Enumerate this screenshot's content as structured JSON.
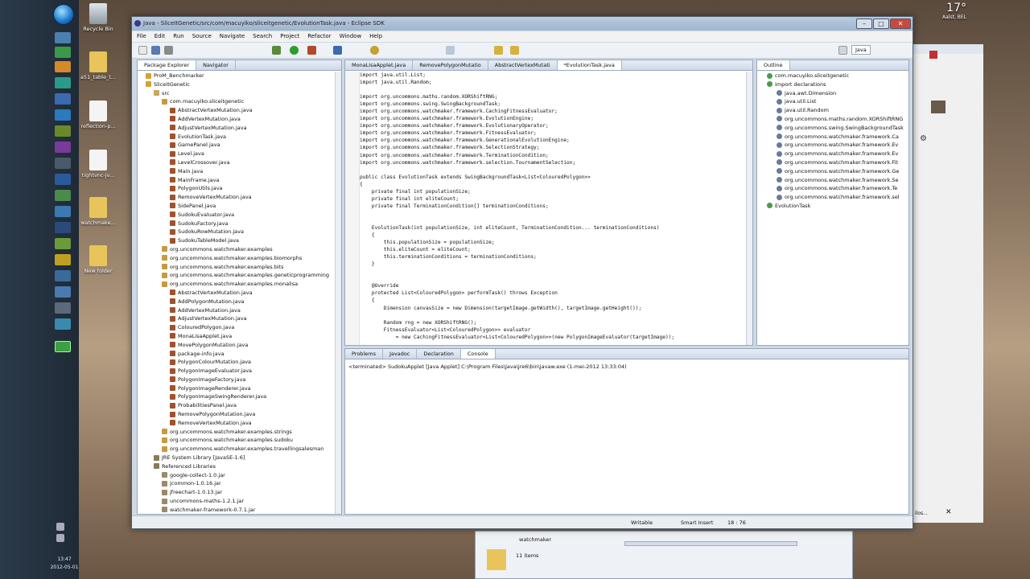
{
  "taskbar": {
    "time": "13:47",
    "date": "2012-05-01",
    "weather_temp": "17°",
    "weather_place": "Aalst, BEL"
  },
  "desktop_icons": [
    {
      "label": "Recycle Bin"
    },
    {
      "label": "a51_table_t..."
    },
    {
      "label": "reflection-p..."
    },
    {
      "label": "tightvnc-jv..."
    },
    {
      "label": "watchmake..."
    },
    {
      "label": "New folder"
    }
  ],
  "explorer": {
    "folder": "watchmaker",
    "count": "11 items"
  },
  "right_window": {
    "text": "ilos..."
  },
  "eclipse": {
    "title": "Java - SliceItGenetic/src/com/macuyiko/sliceitgenetic/EvolutionTask.java - Eclipse SDK",
    "menu": [
      "File",
      "Edit",
      "Run",
      "Source",
      "Navigate",
      "Search",
      "Project",
      "Refactor",
      "Window",
      "Help"
    ],
    "perspective": "Java",
    "left_tabs": [
      "Package Explorer",
      "Navigator"
    ],
    "package_tree": [
      {
        "label": "ProM_Benchmarker",
        "indent": 1,
        "kind": "project"
      },
      {
        "label": "SliceItGenetic",
        "indent": 1,
        "kind": "project"
      },
      {
        "label": "src",
        "indent": 2,
        "kind": "folder"
      },
      {
        "label": "com.macuyiko.sliceitgenetic",
        "indent": 3,
        "kind": "package"
      },
      {
        "label": "AbstractVertexMutation.java",
        "indent": 4,
        "kind": "file"
      },
      {
        "label": "AddVertexMutation.java",
        "indent": 4,
        "kind": "file"
      },
      {
        "label": "AdjustVertexMutation.java",
        "indent": 4,
        "kind": "file"
      },
      {
        "label": "EvolutionTask.java",
        "indent": 4,
        "kind": "file"
      },
      {
        "label": "GamePanel.java",
        "indent": 4,
        "kind": "file"
      },
      {
        "label": "Level.java",
        "indent": 4,
        "kind": "file"
      },
      {
        "label": "LevelCrossover.java",
        "indent": 4,
        "kind": "file"
      },
      {
        "label": "Main.java",
        "indent": 4,
        "kind": "file"
      },
      {
        "label": "MainFrame.java",
        "indent": 4,
        "kind": "file"
      },
      {
        "label": "PolygonUtils.java",
        "indent": 4,
        "kind": "file"
      },
      {
        "label": "RemoveVertexMutation.java",
        "indent": 4,
        "kind": "file"
      },
      {
        "label": "SidePanel.java",
        "indent": 4,
        "kind": "file"
      },
      {
        "label": "SudokuEvaluator.java",
        "indent": 4,
        "kind": "file"
      },
      {
        "label": "SudokuFactory.java",
        "indent": 4,
        "kind": "file"
      },
      {
        "label": "SudokuRowMutation.java",
        "indent": 4,
        "kind": "file"
      },
      {
        "label": "SudokuTableModel.java",
        "indent": 4,
        "kind": "file"
      },
      {
        "label": "org.uncommons.watchmaker.examples",
        "indent": 3,
        "kind": "package"
      },
      {
        "label": "org.uncommons.watchmaker.examples.biomorphs",
        "indent": 3,
        "kind": "package"
      },
      {
        "label": "org.uncommons.watchmaker.examples.bits",
        "indent": 3,
        "kind": "package"
      },
      {
        "label": "org.uncommons.watchmaker.examples.geneticprogramming",
        "indent": 3,
        "kind": "package"
      },
      {
        "label": "org.uncommons.watchmaker.examples.monalisa",
        "indent": 3,
        "kind": "package"
      },
      {
        "label": "AbstractVertexMutation.java",
        "indent": 4,
        "kind": "file"
      },
      {
        "label": "AddPolygonMutation.java",
        "indent": 4,
        "kind": "file"
      },
      {
        "label": "AddVertexMutation.java",
        "indent": 4,
        "kind": "file"
      },
      {
        "label": "AdjustVertexMutation.java",
        "indent": 4,
        "kind": "file"
      },
      {
        "label": "ColouredPolygon.java",
        "indent": 4,
        "kind": "file"
      },
      {
        "label": "MonaLisaApplet.java",
        "indent": 4,
        "kind": "file"
      },
      {
        "label": "MovePolygonMutation.java",
        "indent": 4,
        "kind": "file"
      },
      {
        "label": "package-info.java",
        "indent": 4,
        "kind": "file"
      },
      {
        "label": "PolygonColourMutation.java",
        "indent": 4,
        "kind": "file"
      },
      {
        "label": "PolygonImageEvaluator.java",
        "indent": 4,
        "kind": "file"
      },
      {
        "label": "PolygonImageFactory.java",
        "indent": 4,
        "kind": "file"
      },
      {
        "label": "PolygonImageRenderer.java",
        "indent": 4,
        "kind": "file"
      },
      {
        "label": "PolygonImageSwingRenderer.java",
        "indent": 4,
        "kind": "file"
      },
      {
        "label": "ProbabilitiesPanel.java",
        "indent": 4,
        "kind": "file"
      },
      {
        "label": "RemovePolygonMutation.java",
        "indent": 4,
        "kind": "file"
      },
      {
        "label": "RemoveVertexMutation.java",
        "indent": 4,
        "kind": "file"
      },
      {
        "label": "org.uncommons.watchmaker.examples.strings",
        "indent": 3,
        "kind": "package"
      },
      {
        "label": "org.uncommons.watchmaker.examples.sudoku",
        "indent": 3,
        "kind": "package"
      },
      {
        "label": "org.uncommons.watchmaker.examples.travellingsalesman",
        "indent": 3,
        "kind": "package"
      },
      {
        "label": "JRE System Library [JavaSE-1.6]",
        "indent": 2,
        "kind": "lib"
      },
      {
        "label": "Referenced Libraries",
        "indent": 2,
        "kind": "lib"
      },
      {
        "label": "google-collect-1.0.jar",
        "indent": 3,
        "kind": "jar"
      },
      {
        "label": "jcommon-1.0.16.jar",
        "indent": 3,
        "kind": "jar"
      },
      {
        "label": "jfreechart-1.0.13.jar",
        "indent": 3,
        "kind": "jar"
      },
      {
        "label": "uncommons-maths-1.2.1.jar",
        "indent": 3,
        "kind": "jar"
      },
      {
        "label": "watchmaker-framework-0.7.1.jar",
        "indent": 3,
        "kind": "jar"
      }
    ],
    "editor_tabs": [
      "MonaLisaApplet.java",
      "RemovePolygonMutatio",
      "AbstractVertexMutati",
      "*EvolutionTask.java"
    ],
    "code_lines": [
      "import java.util.List;",
      "import java.util.Random;",
      "",
      "import org.uncommons.maths.random.XORShiftRNG;",
      "import org.uncommons.swing.SwingBackgroundTask;",
      "import org.uncommons.watchmaker.framework.CachingFitnessEvaluator;",
      "import org.uncommons.watchmaker.framework.EvolutionEngine;",
      "import org.uncommons.watchmaker.framework.EvolutionaryOperator;",
      "import org.uncommons.watchmaker.framework.FitnessEvaluator;",
      "import org.uncommons.watchmaker.framework.GenerationalEvolutionEngine;",
      "import org.uncommons.watchmaker.framework.SelectionStrategy;",
      "import org.uncommons.watchmaker.framework.TerminationCondition;",
      "import org.uncommons.watchmaker.framework.selection.TournamentSelection;",
      "",
      "public class EvolutionTask extends SwingBackgroundTask<List<ColouredPolygon>>",
      "{",
      "    private final int populationSize;",
      "    private final int eliteCount;",
      "    private final TerminationCondition[] terminationConditions;",
      "",
      "",
      "    EvolutionTask(int populationSize, int eliteCount, TerminationCondition... terminationConditions)",
      "    {",
      "        this.populationSize = populationSize;",
      "        this.eliteCount = eliteCount;",
      "        this.terminationConditions = terminationConditions;",
      "    }",
      "",
      "",
      "    @Override",
      "    protected List<ColouredPolygon> performTask() throws Exception",
      "    {",
      "        Dimension canvasSize = new Dimension(targetImage.getWidth(), targetImage.getHeight());",
      "",
      "        Random rng = new XORShiftRNG();",
      "        FitnessEvaluator<List<ColouredPolygon>> evaluator",
      "            = new CachingFitnessEvaluator<List<ColouredPolygon>>(new PolygonImageEvaluator(targetImage));"
    ],
    "outline_tab": "Outline",
    "outline_items": [
      {
        "label": "com.macuyiko.sliceitgenetic",
        "indent": 1
      },
      {
        "label": "import declarations",
        "indent": 1
      },
      {
        "label": "java.awt.Dimension",
        "indent": 2
      },
      {
        "label": "java.util.List",
        "indent": 2
      },
      {
        "label": "java.util.Random",
        "indent": 2
      },
      {
        "label": "org.uncommons.maths.random.XORShiftRNG",
        "indent": 2
      },
      {
        "label": "org.uncommons.swing.SwingBackgroundTask",
        "indent": 2
      },
      {
        "label": "org.uncommons.watchmaker.framework.Ca",
        "indent": 2
      },
      {
        "label": "org.uncommons.watchmaker.framework.Ev",
        "indent": 2
      },
      {
        "label": "org.uncommons.watchmaker.framework.Ev",
        "indent": 2
      },
      {
        "label": "org.uncommons.watchmaker.framework.Fit",
        "indent": 2
      },
      {
        "label": "org.uncommons.watchmaker.framework.Ge",
        "indent": 2
      },
      {
        "label": "org.uncommons.watchmaker.framework.Se",
        "indent": 2
      },
      {
        "label": "org.uncommons.watchmaker.framework.Te",
        "indent": 2
      },
      {
        "label": "org.uncommons.watchmaker.framework.sel",
        "indent": 2
      },
      {
        "label": "EvolutionTask",
        "indent": 1
      }
    ],
    "bottom_tabs": [
      "Problems",
      "Javadoc",
      "Declaration",
      "Console"
    ],
    "console_text": "<terminated> SudokuApplet [Java Applet] C:\\Program Files\\Java\\jre6\\bin\\javaw.exe (1-mei-2012 13:33:04)",
    "status": {
      "writable": "Writable",
      "insert_mode": "Smart Insert",
      "position": "18 : 76"
    }
  }
}
